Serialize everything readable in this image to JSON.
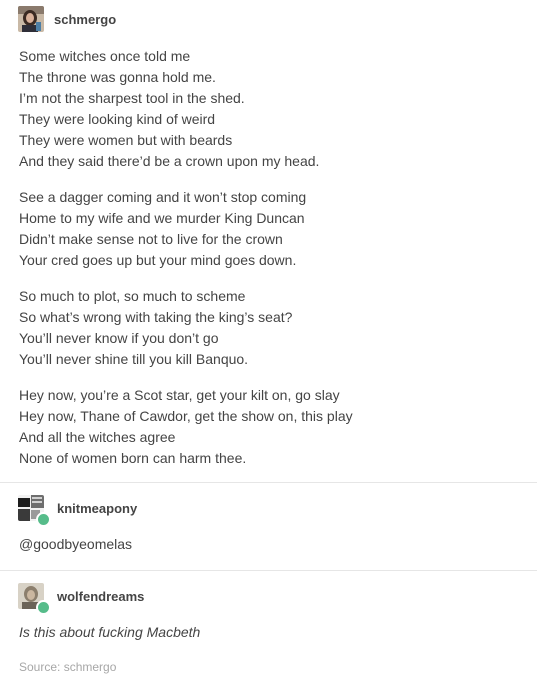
{
  "original_post": {
    "username": "schmergo",
    "avatar_icon": "user-photo-avatar",
    "stanzas": [
      {
        "lines": [
          "Some witches once told me",
          "The throne was gonna hold me.",
          "I’m not the sharpest tool in the shed.",
          "They were looking kind of weird",
          "They were women but with beards",
          "And they said there’d be a crown upon my head."
        ]
      },
      {
        "lines": [
          "See a dagger coming and it won’t stop coming",
          "Home to my wife and we murder King Duncan",
          "Didn’t make sense not to live for the crown",
          "Your cred goes up but your mind goes down."
        ]
      },
      {
        "lines": [
          "So much to plot, so much to scheme",
          "So what’s wrong with taking the king’s seat?",
          "You’ll never know if you don’t go",
          "You’ll never shine till you kill Banquo."
        ]
      },
      {
        "lines": [
          "Hey now, you’re a Scot star, get your kilt on, go slay",
          "Hey now, Thane of Cawdor, get the show on, this play",
          "And all the witches agree",
          "None of women born can harm thee."
        ]
      }
    ]
  },
  "reblogs": [
    {
      "username": "knitmeapony",
      "comment": "@goodbyeomelas",
      "badge_icon": "reblog-icon"
    },
    {
      "username": "wolfendreams",
      "comment": "Is this about fucking Macbeth",
      "badge_icon": "reblog-icon"
    }
  ],
  "source": {
    "text": "Source: schmergo"
  },
  "colors": {
    "text": "#444444",
    "divider": "#e6e6e6",
    "source": "#a7a7a7",
    "reblog_badge": "#56bc8a"
  }
}
